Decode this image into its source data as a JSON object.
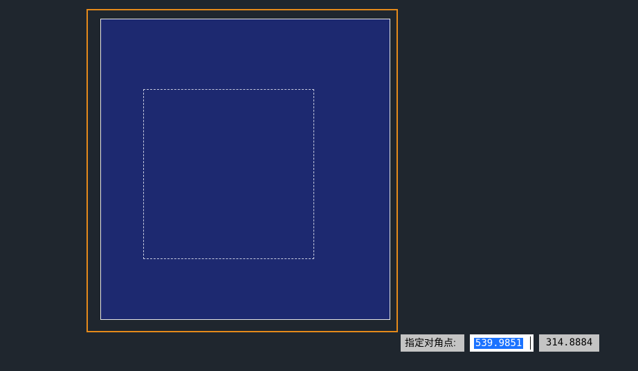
{
  "command": {
    "prompt_label": "指定对角点:",
    "input_value": "539.9851",
    "readout_value": "314.8884"
  }
}
